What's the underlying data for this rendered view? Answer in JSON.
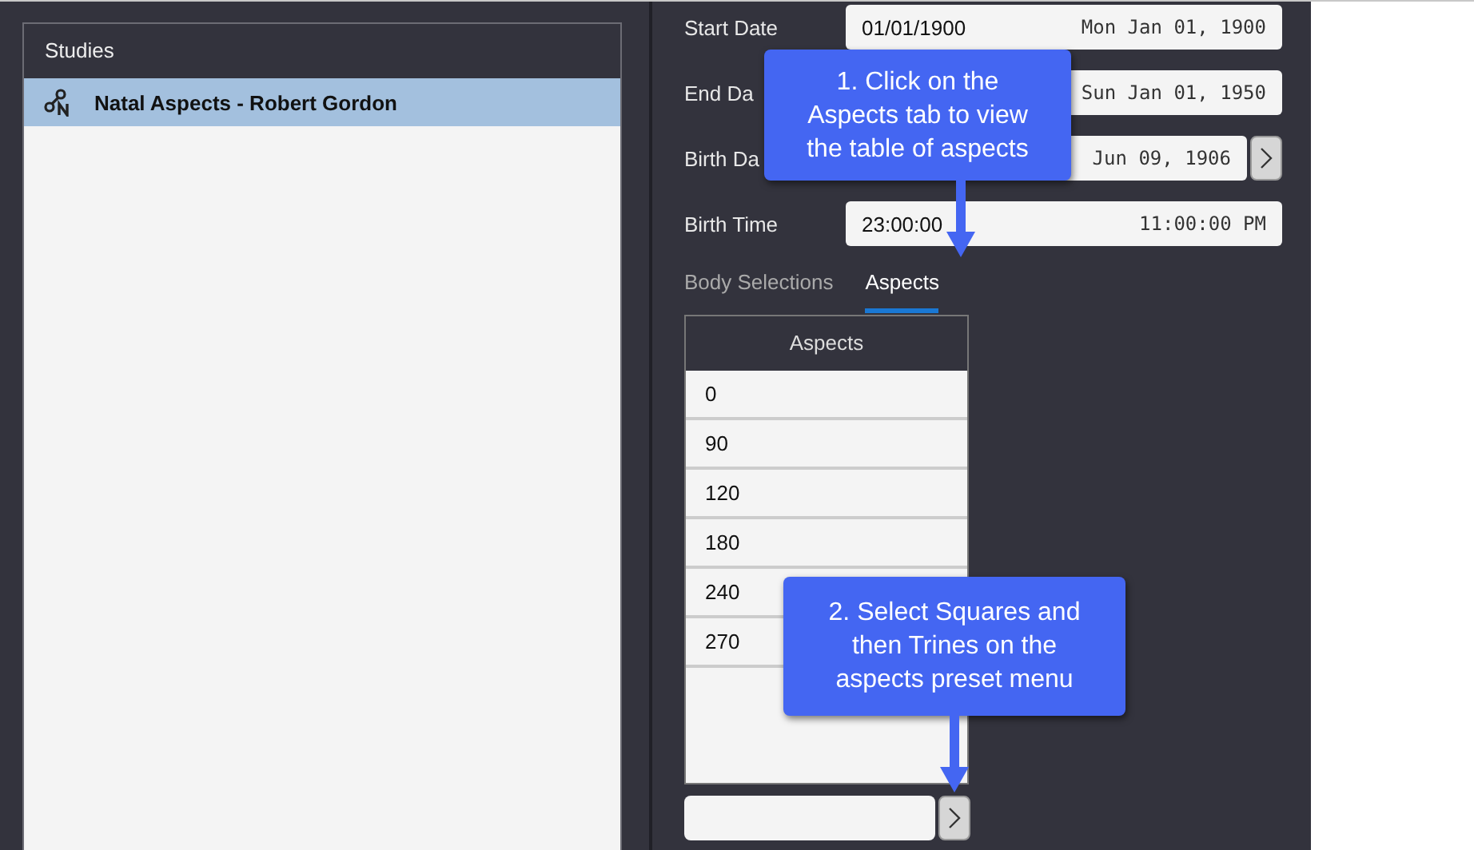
{
  "studies": {
    "title": "Studies",
    "items": [
      {
        "label": "Natal Aspects - Robert Gordon",
        "selected": true
      }
    ]
  },
  "form": {
    "rows": [
      {
        "label": "Start Date",
        "value": "01/01/1900",
        "display": "Mon Jan 01, 1900",
        "has_button": false
      },
      {
        "label": "End Da",
        "value": "",
        "display": "Sun Jan 01, 1950",
        "has_button": false
      },
      {
        "label": "Birth Da",
        "value": "",
        "display": "Jun 09, 1906",
        "has_button": true
      },
      {
        "label": "Birth Time",
        "value": "23:00:00",
        "display": "11:00:00 PM",
        "has_button": false
      }
    ]
  },
  "tabs": [
    {
      "label": "Body Selections",
      "selected": false
    },
    {
      "label": "Aspects",
      "selected": true
    }
  ],
  "aspects_table": {
    "column": "Aspects",
    "rows": [
      "0",
      "90",
      "120",
      "180",
      "240",
      "270"
    ]
  },
  "callouts": [
    {
      "lines": [
        "1. Click on the",
        "Aspects tab to view",
        "the table of aspects"
      ]
    },
    {
      "lines": [
        "2. Select Squares and",
        "then Trines on the",
        "aspects preset menu"
      ]
    }
  ]
}
